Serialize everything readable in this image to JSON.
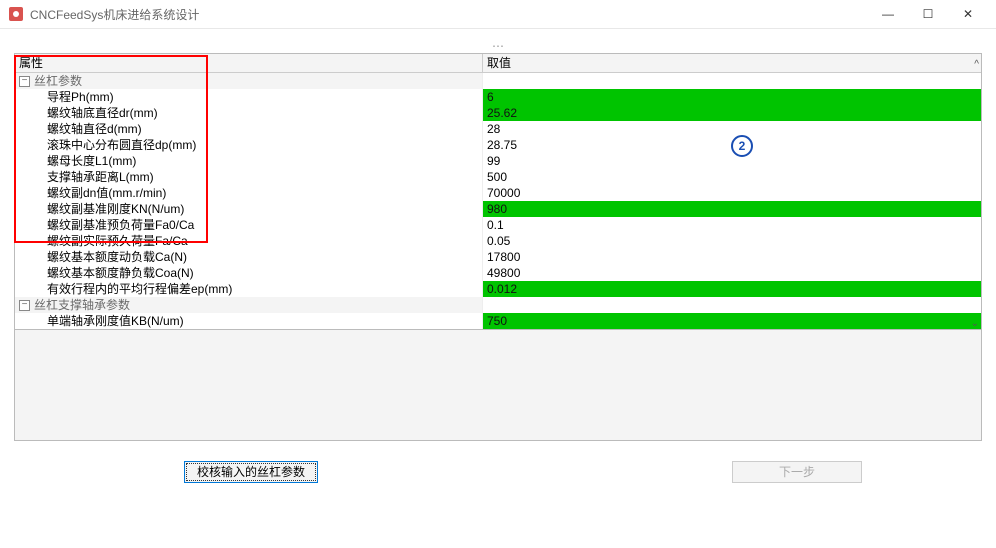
{
  "window": {
    "title": "CNCFeedSys机床进给系统设计",
    "min": "—",
    "max": "☐",
    "close": "✕"
  },
  "header": {
    "prop": "属性",
    "val": "取值"
  },
  "groups": [
    {
      "label": "丝杠参数",
      "rows": [
        {
          "label": "导程Ph(mm)",
          "value": "6",
          "hl": true
        },
        {
          "label": "螺纹轴底直径dr(mm)",
          "value": "25.62",
          "hl": true
        },
        {
          "label": "螺纹轴直径d(mm)",
          "value": "28",
          "hl": false
        },
        {
          "label": "滚珠中心分布圆直径dp(mm)",
          "value": "28.75",
          "hl": false
        },
        {
          "label": "螺母长度L1(mm)",
          "value": "99",
          "hl": false
        },
        {
          "label": "支撑轴承距离L(mm)",
          "value": "500",
          "hl": false
        },
        {
          "label": "螺纹副dn值(mm.r/min)",
          "value": "70000",
          "hl": false
        },
        {
          "label": "螺纹副基准刚度KN(N/um)",
          "value": "980",
          "hl": true
        },
        {
          "label": "螺纹副基准预负荷量Fa0/Ca",
          "value": "0.1",
          "hl": false
        },
        {
          "label": "螺纹副实际预久荷量Fa/Ca",
          "value": "0.05",
          "hl": false
        },
        {
          "label": "螺纹基本额度动负载Ca(N)",
          "value": "17800",
          "hl": false
        },
        {
          "label": "螺纹基本额度静负载Coa(N)",
          "value": "49800",
          "hl": false
        },
        {
          "label": "有效行程内的平均行程偏差ep(mm)",
          "value": "0.012",
          "hl": true
        }
      ]
    },
    {
      "label": "丝杠支撑轴承参数",
      "rows": [
        {
          "label": "单端轴承刚度值KB(N/um)",
          "value": "750",
          "hl": true
        }
      ]
    }
  ],
  "buttons": {
    "check": "校核输入的丝杠参数",
    "next": "下一步"
  },
  "annotation": "2"
}
